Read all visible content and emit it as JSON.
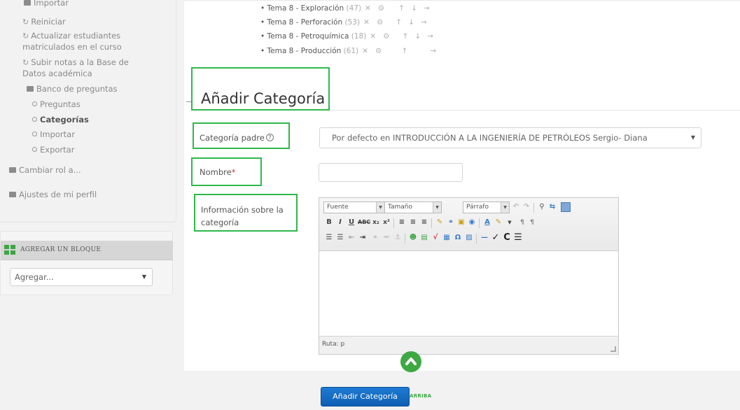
{
  "sidebar": {
    "items": [
      {
        "label": "Importar",
        "icon": "folder-icon"
      },
      {
        "label": "Reiniciar",
        "icon": "reset-icon"
      },
      {
        "label": "Actualizar estudiantes",
        "icon": "reset-icon"
      },
      {
        "label": "matriculados en el curso"
      },
      {
        "label": "Subir notas a la Base de",
        "icon": "reset-icon"
      },
      {
        "label": "Datos académica"
      },
      {
        "label": "Banco de preguntas",
        "icon": "folder-icon"
      },
      {
        "label": "Preguntas",
        "icon": "circle-icon"
      },
      {
        "label": "Categorías",
        "icon": "circle-icon"
      },
      {
        "label": "Importar",
        "icon": "circle-icon"
      },
      {
        "label": "Exportar",
        "icon": "circle-icon"
      },
      {
        "label": "Cambiar rol a...",
        "icon": "folder-icon"
      },
      {
        "label": "Ajustes de mi perfil",
        "icon": "folder-icon"
      }
    ],
    "add_block": {
      "title": "AGREGAR UN BLOQUE",
      "select_value": "Agregar..."
    }
  },
  "topics": [
    {
      "name": "Tema 8 - Exploración",
      "count": "(47)"
    },
    {
      "name": "Tema 8 - Perforación",
      "count": "(53)"
    },
    {
      "name": "Tema 8 - Petroquímica",
      "count": "(18)"
    },
    {
      "name": "Tema 8 - Producción",
      "count": "(61)"
    }
  ],
  "form": {
    "heading": "Añadir Categoría",
    "parent_label": "Categoría padre",
    "parent_value": "Por defecto en INTRODUCCIÓN A LA INGENIERÍA DE PETRÓLEOS Sergio- Diana",
    "name_label": "Nombre",
    "name_required": "*",
    "info_label_1": "Información sobre la",
    "info_label_2": "categoría",
    "submit_label": "Añadir Categoría",
    "to_top_label": "ARRIBA"
  },
  "editor": {
    "font_label": "Fuente",
    "size_label": "Tamaño",
    "paragraph_label": "Párrafo",
    "path_label": "Ruta: p"
  },
  "colors": {
    "highlight_box": "#2fb84a",
    "primary_button": "#1565c0",
    "block_icon": "#3da543"
  }
}
